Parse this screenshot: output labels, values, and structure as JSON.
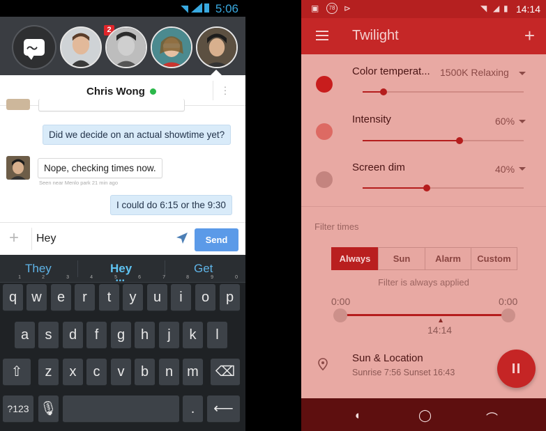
{
  "left_phone": {
    "status": {
      "time": "5:06"
    },
    "chat_heads": {
      "badge": "2"
    },
    "chat": {
      "contact_name": "Chris Wong",
      "messages": [
        {
          "text": "Did we decide on an actual showtime yet?",
          "side": "out"
        },
        {
          "text": "Nope, checking times now.",
          "side": "in"
        },
        {
          "text": "I could do 6:15 or the 9:30",
          "side": "out"
        }
      ],
      "seen_text": "Seen near Menlo park 21 min ago"
    },
    "compose": {
      "value": "Hey",
      "send_label": "Send"
    },
    "keyboard": {
      "suggestions": [
        "They",
        "Hey",
        "Get"
      ],
      "row1": [
        "q",
        "w",
        "e",
        "r",
        "t",
        "y",
        "u",
        "i",
        "o",
        "p"
      ],
      "row1_nums": [
        "1",
        "2",
        "3",
        "4",
        "5",
        "6",
        "7",
        "8",
        "9",
        "0"
      ],
      "row2": [
        "a",
        "s",
        "d",
        "f",
        "g",
        "h",
        "j",
        "k",
        "l"
      ],
      "row3": [
        "z",
        "x",
        "c",
        "v",
        "b",
        "n",
        "m"
      ],
      "symbols_label": "?123",
      "period_label": "."
    }
  },
  "right_phone": {
    "status": {
      "time": "14:14",
      "notification_count": "78"
    },
    "app_title": "Twilight",
    "settings": [
      {
        "label": "Color temperat...",
        "value": "1500K Relaxing",
        "level": 0.13,
        "dot_color": "#c81d1d"
      },
      {
        "label": "Intensity",
        "value": "60%",
        "level": 0.6,
        "dot_color": "#dd6a63"
      },
      {
        "label": "Screen dim",
        "value": "40%",
        "level": 0.4,
        "dot_color": "#c4847f"
      }
    ],
    "filter_times": {
      "section_label": "Filter times",
      "options": [
        "Always",
        "Sun",
        "Alarm",
        "Custom"
      ],
      "active": "Always",
      "info": "Filter is always applied",
      "start": "0:00",
      "end": "0:00",
      "now": "14:14"
    },
    "location": {
      "title": "Sun & Location",
      "subtitle": "Sunrise 7:56 Sunset 16:43"
    },
    "colors": {
      "accent": "#c52727",
      "background": "#e8a9a3"
    }
  }
}
